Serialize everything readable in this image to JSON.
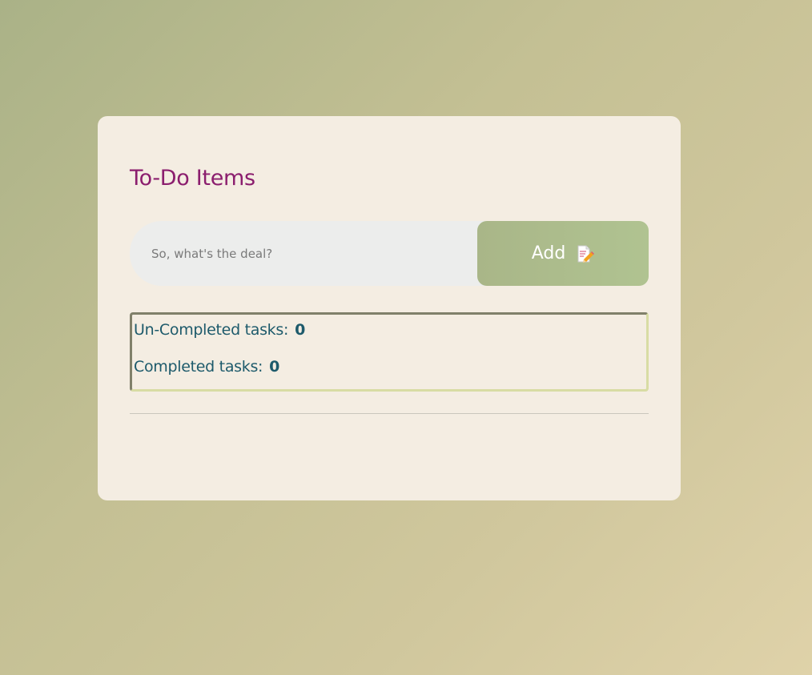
{
  "todo": {
    "title": "To-Do Items",
    "input": {
      "placeholder": "So, what's the deal?",
      "value": ""
    },
    "add_button": {
      "label": "Add",
      "icon": "memo-icon"
    },
    "stats": {
      "uncompleted_label": "Un-Completed tasks:",
      "uncompleted_count": "0",
      "completed_label": "Completed tasks:",
      "completed_count": "0"
    },
    "items": []
  },
  "colors": {
    "title": "#8b1e6e",
    "stat_text": "#1d5a6b",
    "card_bg": "#f4ede2",
    "button_bg": "#adbd8d",
    "input_bg": "#ecedec"
  }
}
